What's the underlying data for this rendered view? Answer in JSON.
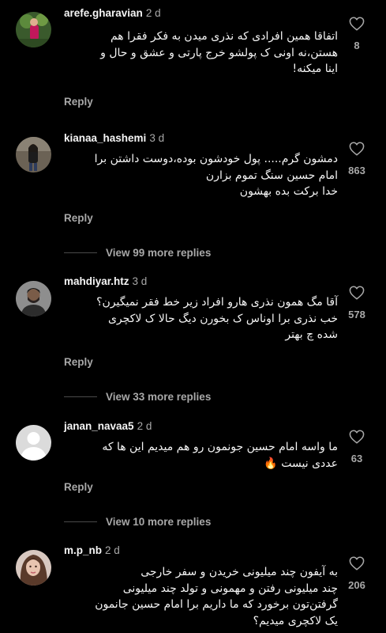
{
  "comments": [
    {
      "username": "arefe.gharavian",
      "time": "2 d",
      "lines": [
        "اتفاقا همین افرادی که نذری میدن به فکر فقرا هم",
        "هستن،نه اونی ک پولشو خرج پارتی و عشق و حال و",
        "اینا میکنه!"
      ],
      "reply_label": "Reply",
      "likes": "8",
      "avatar_icon": "user-photo-avatar"
    },
    {
      "username": "kianaa_hashemi",
      "time": "3 d",
      "lines": [
        "دمشون گرم..... پول خودشون بوده،دوست داشتن برا",
        "امام حسین سنگ تموم بزارن",
        "خدا برکت بده بهشون"
      ],
      "reply_label": "Reply",
      "likes": "863",
      "view_replies": "View 99 more replies",
      "avatar_icon": "user-photo-avatar"
    },
    {
      "username": "mahdiyar.htz",
      "time": "3 d",
      "lines": [
        "آقا مگ همون نذری هارو افراد زیر خط فقر نمیگیرن؟",
        "خب نذری برا اوناس ک بخورن دیگ حالا ک لاکچری",
        "شده چ بهتر"
      ],
      "reply_label": "Reply",
      "likes": "578",
      "view_replies": "View 33 more replies",
      "avatar_icon": "user-photo-avatar"
    },
    {
      "username": "janan_navaa5",
      "time": "2 d",
      "lines": [
        "ما واسه امام حسین جونمون رو هم میدیم این ها که",
        "عددی نیست 🔥"
      ],
      "reply_label": "Reply",
      "likes": "63",
      "view_replies": "View 10 more replies",
      "avatar_icon": "default-user-avatar"
    },
    {
      "username": "m.p_nb",
      "time": "2 d",
      "lines": [
        "به آیفون چند میلیونی خریدن و سفر خارجی",
        "چند میلیونی رفتن و مهمونی و تولد چند میلیونی",
        "گرفتن‌تون برخورد که ما داریم برا امام حسین جانمون",
        "یک لاکچری میدیم؟"
      ],
      "likes": "206",
      "avatar_icon": "user-photo-avatar"
    }
  ],
  "icons": {
    "like": "heart-outline-icon"
  },
  "colors": {
    "background": "#000000",
    "text": "#f5f5f5",
    "secondary": "#a8a8a8"
  }
}
